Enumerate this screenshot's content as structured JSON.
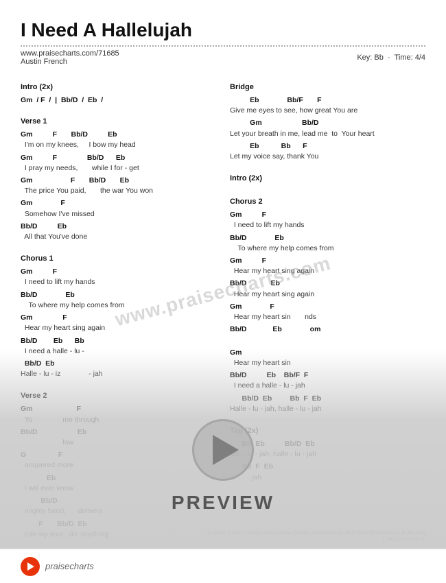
{
  "title": "I Need A Hallelujah",
  "url": "www.praisecharts.com/71685",
  "artist": "Austin French",
  "key": "Key: Bb",
  "time": "Time: 4/4",
  "watermark": "www.praisecharts.com",
  "preview_label": "PREVIEW",
  "footer_brand": "praisecharts",
  "copyright": "© Austin French; Meaux Jeaux Music (Admin. FrenchMusic, Fair Trade Global Music Publishing L. ing is prohibited.",
  "sections": {
    "intro": {
      "title": "Intro (2x)",
      "lines": [
        {
          "type": "chord",
          "text": "Gm  / F  /  |  Bb/D  /  Eb  /"
        }
      ]
    },
    "verse1": {
      "title": "Verse 1",
      "lines": [
        {
          "type": "chord",
          "text": "Gm          F       Bb/D          Eb"
        },
        {
          "type": "lyric",
          "text": "  I'm on my knees,     I bow my head"
        },
        {
          "type": "chord",
          "text": "Gm          F               Bb/D      Eb"
        },
        {
          "type": "lyric",
          "text": "  I pray my needs,       while I for - get"
        },
        {
          "type": "chord",
          "text": "Gm                   F       Bb/D       Eb"
        },
        {
          "type": "lyric",
          "text": "  The price You paid,       the war You won"
        },
        {
          "type": "chord",
          "text": "Gm              F"
        },
        {
          "type": "lyric",
          "text": "  Somehow I've missed"
        },
        {
          "type": "chord",
          "text": "Bb/D          Eb"
        },
        {
          "type": "lyric",
          "text": "  All that You've done"
        }
      ]
    },
    "chorus1": {
      "title": "Chorus 1",
      "lines": [
        {
          "type": "chord",
          "text": "Gm          F"
        },
        {
          "type": "lyric",
          "text": "  I need to lift my hands"
        },
        {
          "type": "chord",
          "text": "Bb/D              Eb"
        },
        {
          "type": "lyric",
          "text": "    To where my help comes from"
        },
        {
          "type": "chord",
          "text": "Gm               F"
        },
        {
          "type": "lyric",
          "text": "  Hear my heart sing again"
        },
        {
          "type": "chord",
          "text": "Bb/D        Eb      Bb"
        },
        {
          "type": "lyric",
          "text": "  I need a halle - lu -"
        },
        {
          "type": "chord",
          "text": "  Bb/D  Eb"
        },
        {
          "type": "lyric",
          "text": "  Halle - lu - iz              - jah"
        }
      ]
    },
    "verse2": {
      "title": "Verse 2",
      "lines": [
        {
          "type": "chord",
          "text": "Gm                      F"
        },
        {
          "type": "lyric",
          "text": "  Yo               me through"
        },
        {
          "type": "chord",
          "text": "Bb/D                    Eb"
        },
        {
          "type": "lyric",
          "text": "                     low"
        },
        {
          "type": "chord",
          "text": "G                F"
        },
        {
          "type": "lyric",
          "text": "  onquered more"
        },
        {
          "type": "chord",
          "text": "             Eb"
        },
        {
          "type": "lyric",
          "text": "  I will ever know"
        },
        {
          "type": "chord",
          "text": "          Bb/D"
        },
        {
          "type": "lyric",
          "text": "  mighty hand,      delivers"
        },
        {
          "type": "chord",
          "text": "         F       Bb/D  Eb"
        },
        {
          "type": "lyric",
          "text": "  can my soul,  do  anything"
        }
      ]
    }
  },
  "right_sections": {
    "bridge": {
      "title": "Bridge",
      "lines": [
        {
          "type": "chord",
          "text": "          Eb              Bb/F       F"
        },
        {
          "type": "lyric",
          "text": "Give me eyes to see, how great You are"
        },
        {
          "type": "chord",
          "text": "          Gm                    Bb/D"
        },
        {
          "type": "lyric",
          "text": "Let your breath in me, lead me  to  Your heart"
        },
        {
          "type": "chord",
          "text": "          Eb           Bb      F"
        },
        {
          "type": "lyric",
          "text": "Let my voice say, thank You"
        }
      ]
    },
    "intro2": {
      "title": "Intro (2x)"
    },
    "chorus2": {
      "title": "Chorus 2",
      "lines": [
        {
          "type": "chord",
          "text": "Gm          F"
        },
        {
          "type": "lyric",
          "text": "  I need to lift my hands"
        },
        {
          "type": "chord",
          "text": "Bb/D              Eb"
        },
        {
          "type": "lyric",
          "text": "    To where my help comes from"
        },
        {
          "type": "chord",
          "text": "Gm          F"
        },
        {
          "type": "lyric",
          "text": "  Hear my heart sing again"
        },
        {
          "type": "chord",
          "text": "Bb/D            Eb"
        },
        {
          "type": "lyric",
          "text": "  Hear my heart sing again"
        },
        {
          "type": "chord",
          "text": "Gm              F          nds"
        },
        {
          "type": "lyric",
          "text": "  Hear my heart si            "
        },
        {
          "type": "chord",
          "text": "Bb/D             Eb             om"
        },
        {
          "type": "lyric",
          "text": "                               "
        },
        {
          "type": "chord",
          "text": "Gm"
        },
        {
          "type": "lyric",
          "text": "  Hear my heart sin"
        },
        {
          "type": "chord",
          "text": "Bb/D          Eb    Bb/F  F"
        },
        {
          "type": "lyric",
          "text": "  I need a halle - lu - jah"
        },
        {
          "type": "chord",
          "text": "      Bb/D  Eb         Bb  F  Eb"
        },
        {
          "type": "lyric",
          "text": "Halle - lu - jah, halle - lu - jah"
        }
      ]
    },
    "tag": {
      "title": "Tag (2x)",
      "lines": [
        {
          "type": "chord",
          "text": "      Bb  Eb          Bb/D  Eb"
        },
        {
          "type": "lyric",
          "text": "alle - lu - jah, halle - lu - jah"
        },
        {
          "type": "chord",
          "text": "      Bb  F  Eb"
        },
        {
          "type": "lyric",
          "text": "           jah"
        }
      ]
    }
  }
}
